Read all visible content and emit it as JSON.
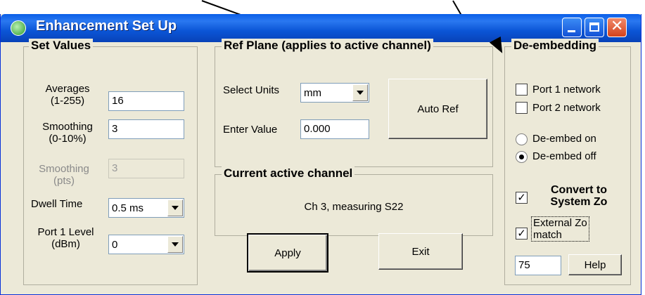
{
  "window": {
    "title": "Enhancement Set Up"
  },
  "set_values": {
    "legend": "Set Values",
    "averages_label": "Averages\n(1-255)",
    "averages_value": "16",
    "smoothing_pct_label": "Smoothing\n(0-10%)",
    "smoothing_pct_value": "3",
    "smoothing_pts_label": "Smoothing\n(pts)",
    "smoothing_pts_value": "3",
    "dwell_label": "Dwell Time",
    "dwell_value": "0.5 ms",
    "port1_label": "Port 1 Level\n(dBm)",
    "port1_value": "0"
  },
  "ref_plane": {
    "legend": "Ref Plane (applies to active channel)",
    "units_label": "Select Units",
    "units_value": "mm",
    "enter_label": "Enter Value",
    "enter_value": "0.000",
    "auto_ref": "Auto Ref"
  },
  "active_channel": {
    "legend": "Current active channel",
    "text": "Ch 3, measuring S22"
  },
  "buttons": {
    "apply": "Apply",
    "exit": "Exit",
    "help": "Help"
  },
  "de_embedding": {
    "legend": "De-embedding",
    "port1": "Port 1 network",
    "port2": "Port 2 network",
    "on": "De-embed on",
    "off": "De-embed off",
    "convert": "Convert to\nSystem Zo",
    "external": "External Zo\nmatch",
    "zo_value": "75",
    "convert_checked": true,
    "external_checked": true,
    "port1_checked": false,
    "port2_checked": false,
    "selected": "off"
  },
  "colors": {
    "titlebar": "#0a5fe8",
    "face": "#ece9d8",
    "close": "#d4421c"
  },
  "icons": {
    "app": "app-icon",
    "min": "minimize-icon",
    "max": "maximize-icon",
    "close": "close-icon"
  }
}
